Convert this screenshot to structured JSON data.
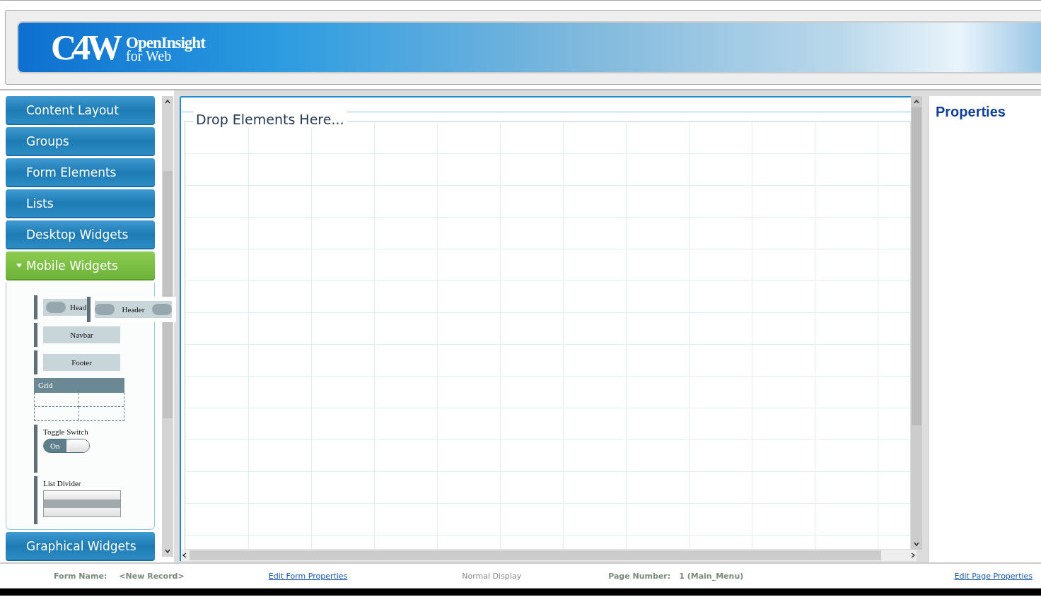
{
  "banner": {
    "logo_mark": "C4W",
    "logo_title": "OpenInsight",
    "logo_subtitle": "for Web"
  },
  "toolbox": {
    "sections": [
      {
        "label": "Content Layout",
        "expanded": false
      },
      {
        "label": "Groups",
        "expanded": false
      },
      {
        "label": "Form Elements",
        "expanded": false
      },
      {
        "label": "Lists",
        "expanded": false
      },
      {
        "label": "Desktop Widgets",
        "expanded": false
      },
      {
        "label": "Mobile Widgets",
        "expanded": true,
        "widgets": [
          {
            "kind": "header",
            "label": "Head",
            "drag_label": "Header"
          },
          {
            "kind": "bar",
            "label": "Navbar"
          },
          {
            "kind": "bar",
            "label": "Footer"
          },
          {
            "kind": "grid",
            "label": "Grid"
          },
          {
            "kind": "toggle",
            "label": "Toggle Switch",
            "switch_label": "On",
            "on": true
          },
          {
            "kind": "divider",
            "label": "List Divider"
          }
        ]
      },
      {
        "label": "Graphical Widgets",
        "expanded": false
      }
    ]
  },
  "canvas": {
    "drop_hint": "Drop Elements Here..."
  },
  "properties": {
    "title": "Properties"
  },
  "status_bar": {
    "form_name_label": "Form Name:",
    "form_name": "<New Record>",
    "edit_form_link": "Edit Form Properties",
    "display_mode": "Normal Display",
    "page_number_label": "Page Number:",
    "page_number": "1 (Main_Menu)",
    "edit_page_link": "Edit Page Properties"
  }
}
